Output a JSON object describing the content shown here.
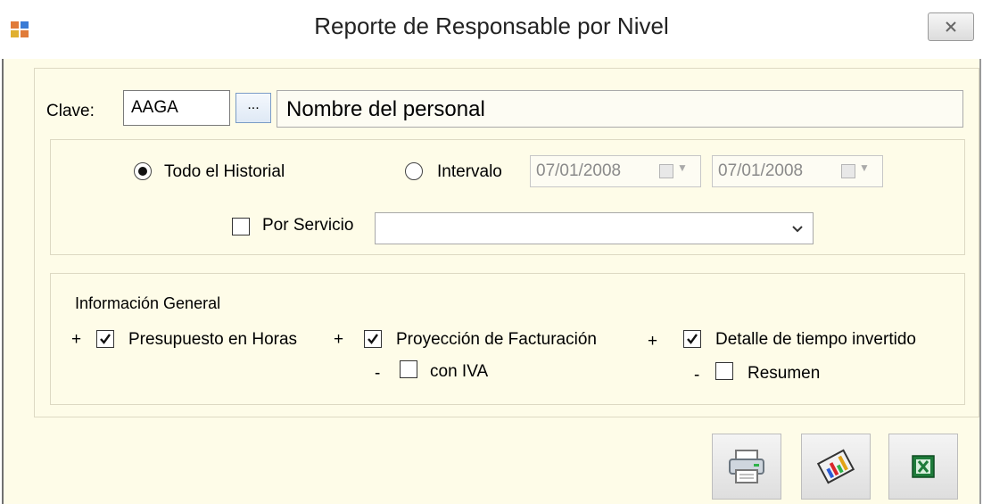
{
  "window": {
    "title": "Reporte de Responsable por Nivel",
    "close_icon": "close-icon",
    "app_icon": "app-window-icon"
  },
  "clave": {
    "label": "Clave:",
    "value": "AAGA",
    "browse_label": "...",
    "name_value": "Nombre del personal"
  },
  "periodo": {
    "todo_label": "Todo el Historial",
    "todo_selected": true,
    "intervalo_label": "Intervalo",
    "intervalo_selected": false,
    "fecha_inicio": "07/01/2008",
    "fecha_fin": "07/01/2008",
    "por_servicio_label": "Por Servicio",
    "por_servicio_checked": false,
    "servicio_value": ""
  },
  "info_general": {
    "title": "Información General",
    "items": [
      {
        "prefix": "+",
        "label": "Presupuesto en Horas",
        "checked": true
      },
      {
        "prefix": "+",
        "label": "Proyección de Facturación",
        "checked": true
      },
      {
        "prefix": "+",
        "label": "Detalle de tiempo invertido",
        "checked": true
      },
      {
        "prefix": "-",
        "label": "con IVA",
        "checked": false
      },
      {
        "prefix": "-",
        "label": "Resumen",
        "checked": false
      }
    ]
  },
  "buttons": {
    "print_icon": "printer-icon",
    "report_icon": "report-chart-icon",
    "excel_icon": "excel-icon"
  },
  "colors": {
    "window_bg": "#fefce8",
    "panel_border": "#ddd9c3",
    "disabled_text": "#8a8a8a"
  }
}
